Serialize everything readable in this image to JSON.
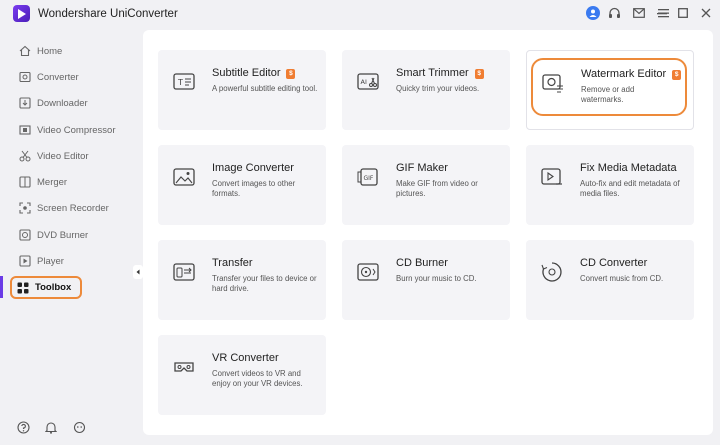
{
  "app": {
    "title": "Wondershare UniConverter"
  },
  "titlebar_icons": [
    "user-icon",
    "headset-icon",
    "mail-icon",
    "menu-icon",
    "minimize-icon",
    "maximize-icon",
    "close-icon"
  ],
  "sidebar": {
    "items": [
      {
        "label": "Home",
        "icon": "home-icon"
      },
      {
        "label": "Converter",
        "icon": "converter-icon"
      },
      {
        "label": "Downloader",
        "icon": "downloader-icon"
      },
      {
        "label": "Video Compressor",
        "icon": "compressor-icon"
      },
      {
        "label": "Video Editor",
        "icon": "scissors-icon"
      },
      {
        "label": "Merger",
        "icon": "merger-icon"
      },
      {
        "label": "Screen Recorder",
        "icon": "screen-recorder-icon"
      },
      {
        "label": "DVD Burner",
        "icon": "dvd-icon"
      },
      {
        "label": "Player",
        "icon": "player-icon"
      },
      {
        "label": "Toolbox",
        "icon": "grid-icon",
        "active": true
      }
    ],
    "bottom_icons": [
      "help-icon",
      "bell-icon",
      "feedback-icon"
    ]
  },
  "tools": [
    {
      "title": "Subtitle Editor",
      "desc": "A powerful subtitle editing tool.",
      "badge": "$",
      "icon": "subtitle-icon"
    },
    {
      "title": "Smart Trimmer",
      "desc": "Quicky trim your videos.",
      "badge": "$",
      "icon": "trimmer-icon"
    },
    {
      "title": "Watermark Editor",
      "desc": "Remove or add watermarks.",
      "badge": "$",
      "icon": "watermark-icon",
      "highlight": true
    },
    {
      "title": "Image Converter",
      "desc": "Convert images to other formats.",
      "icon": "image-icon"
    },
    {
      "title": "GIF Maker",
      "desc": "Make GIF from video or pictures.",
      "icon": "gif-icon"
    },
    {
      "title": "Fix Media Metadata",
      "desc": "Auto-fix and edit metadata of media files.",
      "icon": "metadata-icon"
    },
    {
      "title": "Transfer",
      "desc": "Transfer your files to device or hard drive.",
      "icon": "transfer-icon"
    },
    {
      "title": "CD Burner",
      "desc": "Burn your music to CD.",
      "icon": "cd-burner-icon"
    },
    {
      "title": "CD Converter",
      "desc": "Convert music from CD.",
      "icon": "cd-converter-icon"
    },
    {
      "title": "VR Converter",
      "desc": "Convert videos to VR and enjoy on your VR devices.",
      "icon": "vr-icon"
    }
  ],
  "colors": {
    "accent": "#6b3be6",
    "highlight": "#ed8a3a",
    "badge": "#f07d32"
  }
}
